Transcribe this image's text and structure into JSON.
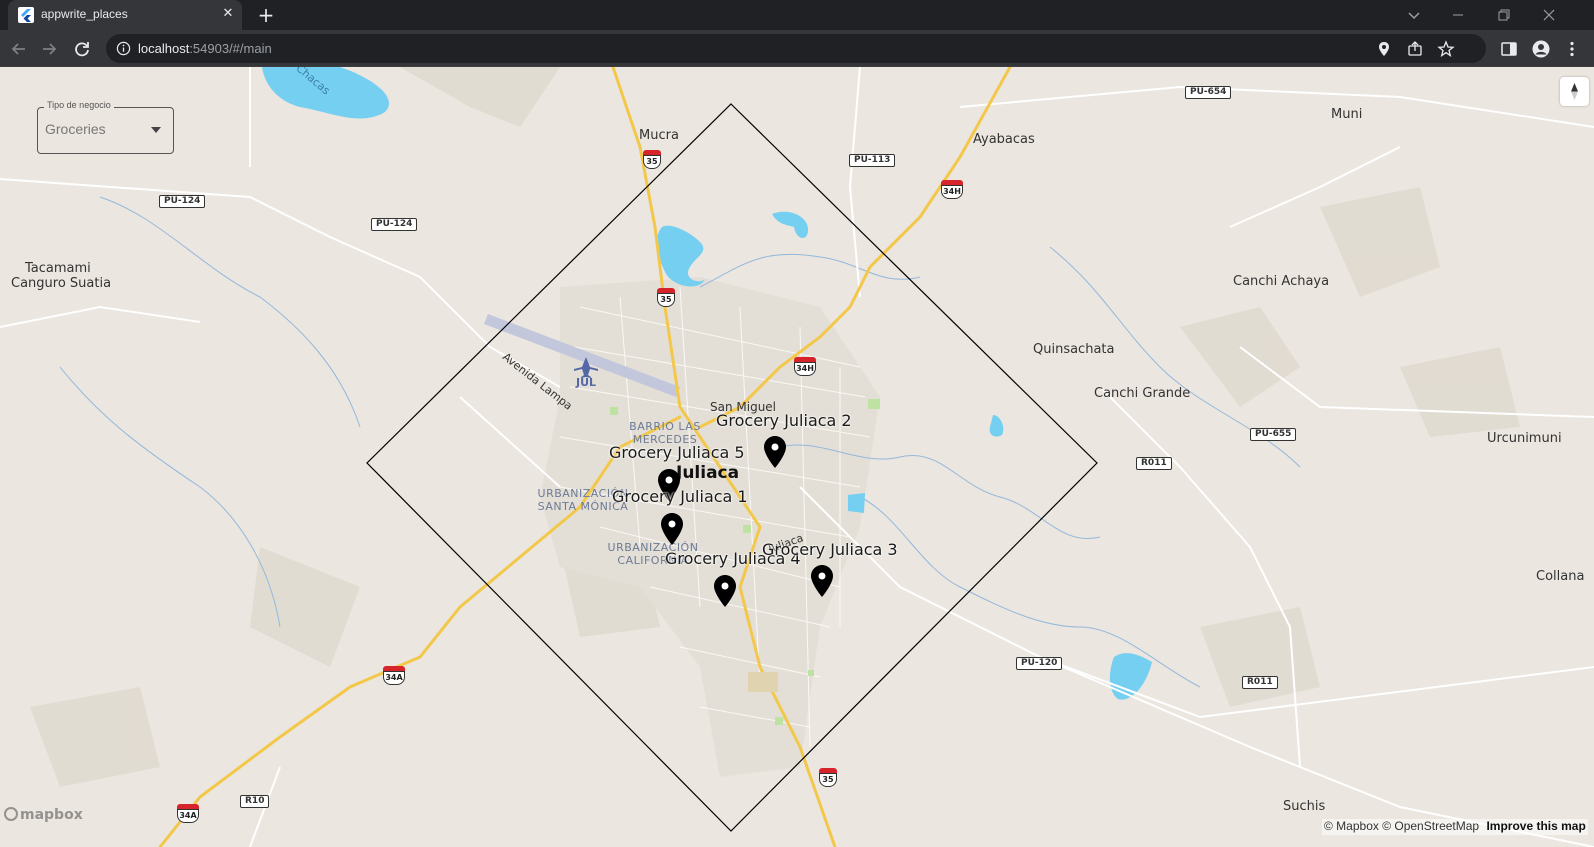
{
  "browser": {
    "tab_title": "appwrite_places",
    "url_host": "localhost",
    "url_rest": ":54903/#/main"
  },
  "filter": {
    "label": "Tipo de negocio",
    "value": "Groceries"
  },
  "map": {
    "places": {
      "mucra": "Mucra",
      "ayabacas": "Ayabacas",
      "muni": "Muni",
      "tacamami": "Tacamami",
      "canguro": "Canguro Suatia",
      "canchi_achaya": "Canchi Achaya",
      "quinsachata": "Quinsachata",
      "canchi_grande": "Canchi Grande",
      "urcunimuni": "Urcunimuni",
      "collana": "Collana",
      "suchis": "Suchis",
      "san_miguel": "San Miguel",
      "juliaca": "Juliaca",
      "chacas": "Chacas",
      "avenida_lampa": "Avenida Lampa",
      "jul": "JUL",
      "juliaca_street": "Juliaca"
    },
    "suburbs": {
      "barrio": "BARRIO LAS MERCEDES",
      "urb_santa": "URBANIZACIÓN SANTA MÓNICA",
      "urb_cal": "URBANIZACIÓN CALIFORNIA"
    },
    "roads": {
      "pu654": "PU-654",
      "pu113": "PU-113",
      "pu124a": "PU-124",
      "pu124b": "PU-124",
      "pu655": "PU-655",
      "r011a": "R011",
      "r011b": "R011",
      "pu120": "PU-120",
      "r10": "R10",
      "n35a": "35",
      "n35b": "35",
      "n35c": "35",
      "n34h_a": "34H",
      "n34h_b": "34H",
      "n34a_a": "34A",
      "n34a_b": "34A"
    },
    "markers": [
      {
        "label": "Grocery Juliaca 2"
      },
      {
        "label": "Grocery Juliaca 5"
      },
      {
        "label": "Grocery Juliaca 1"
      },
      {
        "label": "Grocery Juliaca 4"
      },
      {
        "label": "Grocery Juliaca 3"
      }
    ],
    "logo": "mapbox",
    "attribution": {
      "text": "© Mapbox © OpenStreetMap",
      "improve": "Improve this map"
    }
  },
  "colors": {
    "water": "#75cff0",
    "highway": "#f3c84a",
    "land": "#ebe6df",
    "polygon": "#000000"
  }
}
